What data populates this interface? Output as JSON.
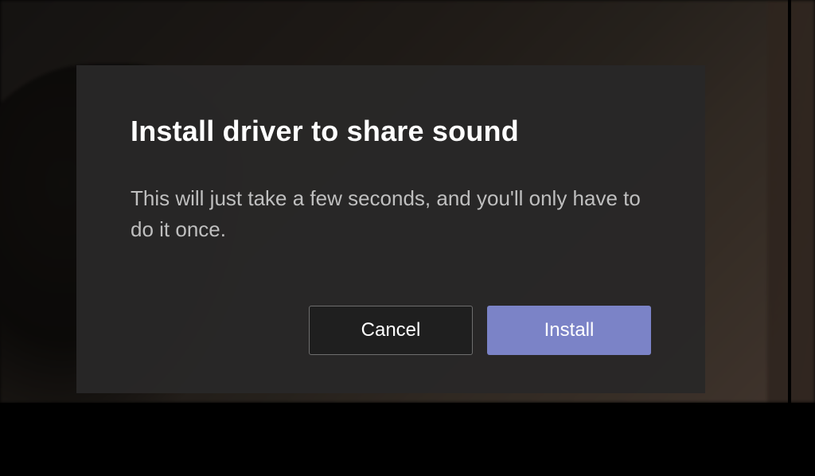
{
  "dialog": {
    "title": "Install driver to share sound",
    "body": "This will just take a few seconds, and you'll only have to do it once.",
    "buttons": {
      "cancel": "Cancel",
      "install": "Install"
    }
  },
  "colors": {
    "accent": "#7b83c7",
    "modal_bg": "#292828",
    "text_primary": "#ffffff",
    "text_secondary": "#bfbfbf"
  }
}
